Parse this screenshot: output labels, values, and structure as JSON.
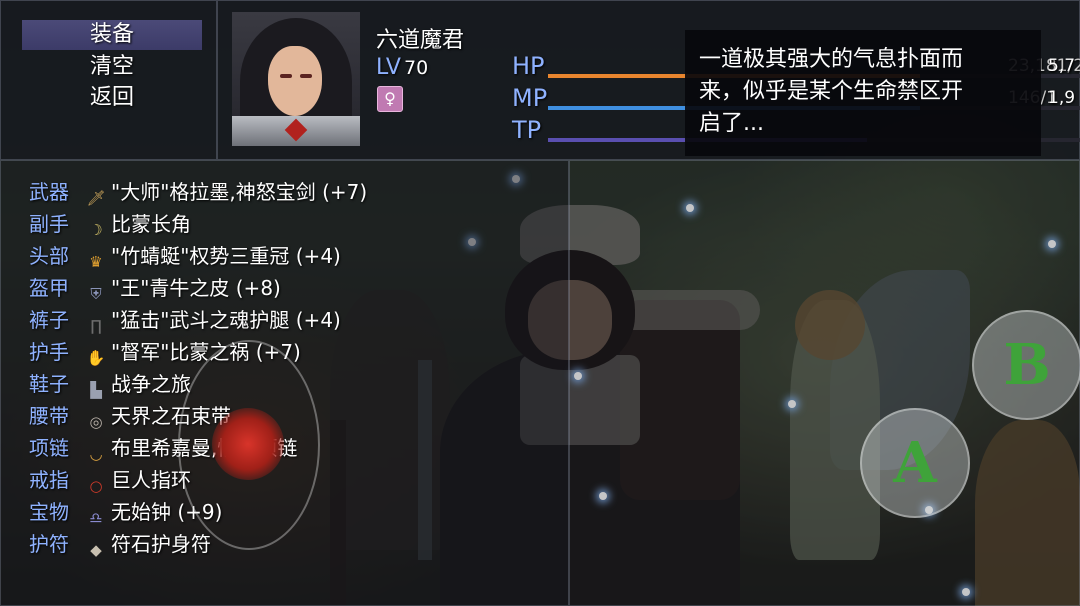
{
  "menu": {
    "items": [
      {
        "label": "装备",
        "selected": true
      },
      {
        "label": "清空",
        "selected": false
      },
      {
        "label": "返回",
        "selected": false
      }
    ]
  },
  "character": {
    "name": "六道魔君",
    "level_label": "LV",
    "level": "70",
    "state_icon": "female-symbol-icon"
  },
  "gauges": [
    {
      "label": "HP",
      "value_partial": "23,181/2",
      "value_right": "5,7",
      "color": "#e8852e",
      "fill": 0.7
    },
    {
      "label": "MP",
      "value_partial": "146/1",
      "value_right": "1,9",
      "color": "#3f8fe0",
      "fill": 0.7
    },
    {
      "label": "TP",
      "value_partial": "",
      "value_right": "",
      "color": "#5a4fb0",
      "fill": 0.6
    }
  ],
  "message": {
    "lines": [
      "一道极其强大的气息扑面而",
      "来，似乎是某个生命禁区开",
      "启了..."
    ]
  },
  "equipment": [
    {
      "slot": "武器",
      "icon": "sword-icon",
      "glyph": "🗡",
      "icon_color": "#c8a25a",
      "name": "\"大师\"格拉墨,神怒宝剑 (+7)"
    },
    {
      "slot": "副手",
      "icon": "horn-icon",
      "glyph": "☽",
      "icon_color": "#d6c46a",
      "name": "比蒙长角"
    },
    {
      "slot": "头部",
      "icon": "crown-icon",
      "glyph": "♛",
      "icon_color": "#e0a030",
      "name": "\"竹蜻蜓\"权势三重冠 (+4)"
    },
    {
      "slot": "盔甲",
      "icon": "armor-icon",
      "glyph": "⛨",
      "icon_color": "#8a94b8",
      "name": "\"王\"青牛之皮 (+8)"
    },
    {
      "slot": "裤子",
      "icon": "leggings-icon",
      "glyph": "∏",
      "icon_color": "#6d6d6d",
      "name": "\"猛击\"武斗之魂护腿 (+4)"
    },
    {
      "slot": "护手",
      "icon": "gauntlet-icon",
      "glyph": "✋",
      "icon_color": "#c08a50",
      "name": "\"督军\"比蒙之祸 (+7)"
    },
    {
      "slot": "鞋子",
      "icon": "boots-icon",
      "glyph": "▙",
      "icon_color": "#9aa0b0",
      "name": "战争之旅"
    },
    {
      "slot": "腰带",
      "icon": "belt-icon",
      "glyph": "◎",
      "icon_color": "#b8b0a8",
      "name": "天界之石束带"
    },
    {
      "slot": "项链",
      "icon": "necklace-icon",
      "glyph": "◡",
      "icon_color": "#d8a040",
      "name": "布里希嘉曼,情热项链"
    },
    {
      "slot": "戒指",
      "icon": "ring-icon",
      "glyph": "○",
      "icon_color": "#d03a2a",
      "name": "巨人指环"
    },
    {
      "slot": "宝物",
      "icon": "bell-icon",
      "glyph": "♎",
      "icon_color": "#8a8ad0",
      "name": "无始钟 (+9)"
    },
    {
      "slot": "护符",
      "icon": "amulet-stone-icon",
      "glyph": "◆",
      "icon_color": "#c8c0b0",
      "name": "符石护身符"
    }
  ],
  "controls": {
    "button_a": "A",
    "button_b": "B"
  }
}
